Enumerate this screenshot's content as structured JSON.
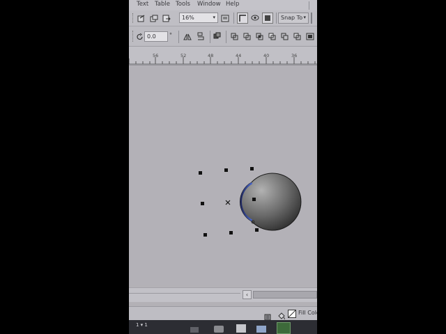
{
  "menu": [
    "Text",
    "Table",
    "Tools",
    "Window",
    "Help"
  ],
  "toolbar": {
    "zoom_value": "16%",
    "snap_label": "Snap To",
    "rotation_value": "0.0",
    "rotation_unit": "°"
  },
  "ruler": {
    "labels": [
      "56",
      "52",
      "48",
      "44",
      "40",
      "36"
    ]
  },
  "status": {
    "fill_label": "Fill Colo",
    "page_indicator": "1 ▾ 1"
  },
  "canvas": {
    "object_name": "crescent-sphere",
    "colors": {
      "shape_dark": "#2a2a2a",
      "shape_light": "#b2b2b2",
      "rim_blue": "#2b3f8f"
    }
  }
}
